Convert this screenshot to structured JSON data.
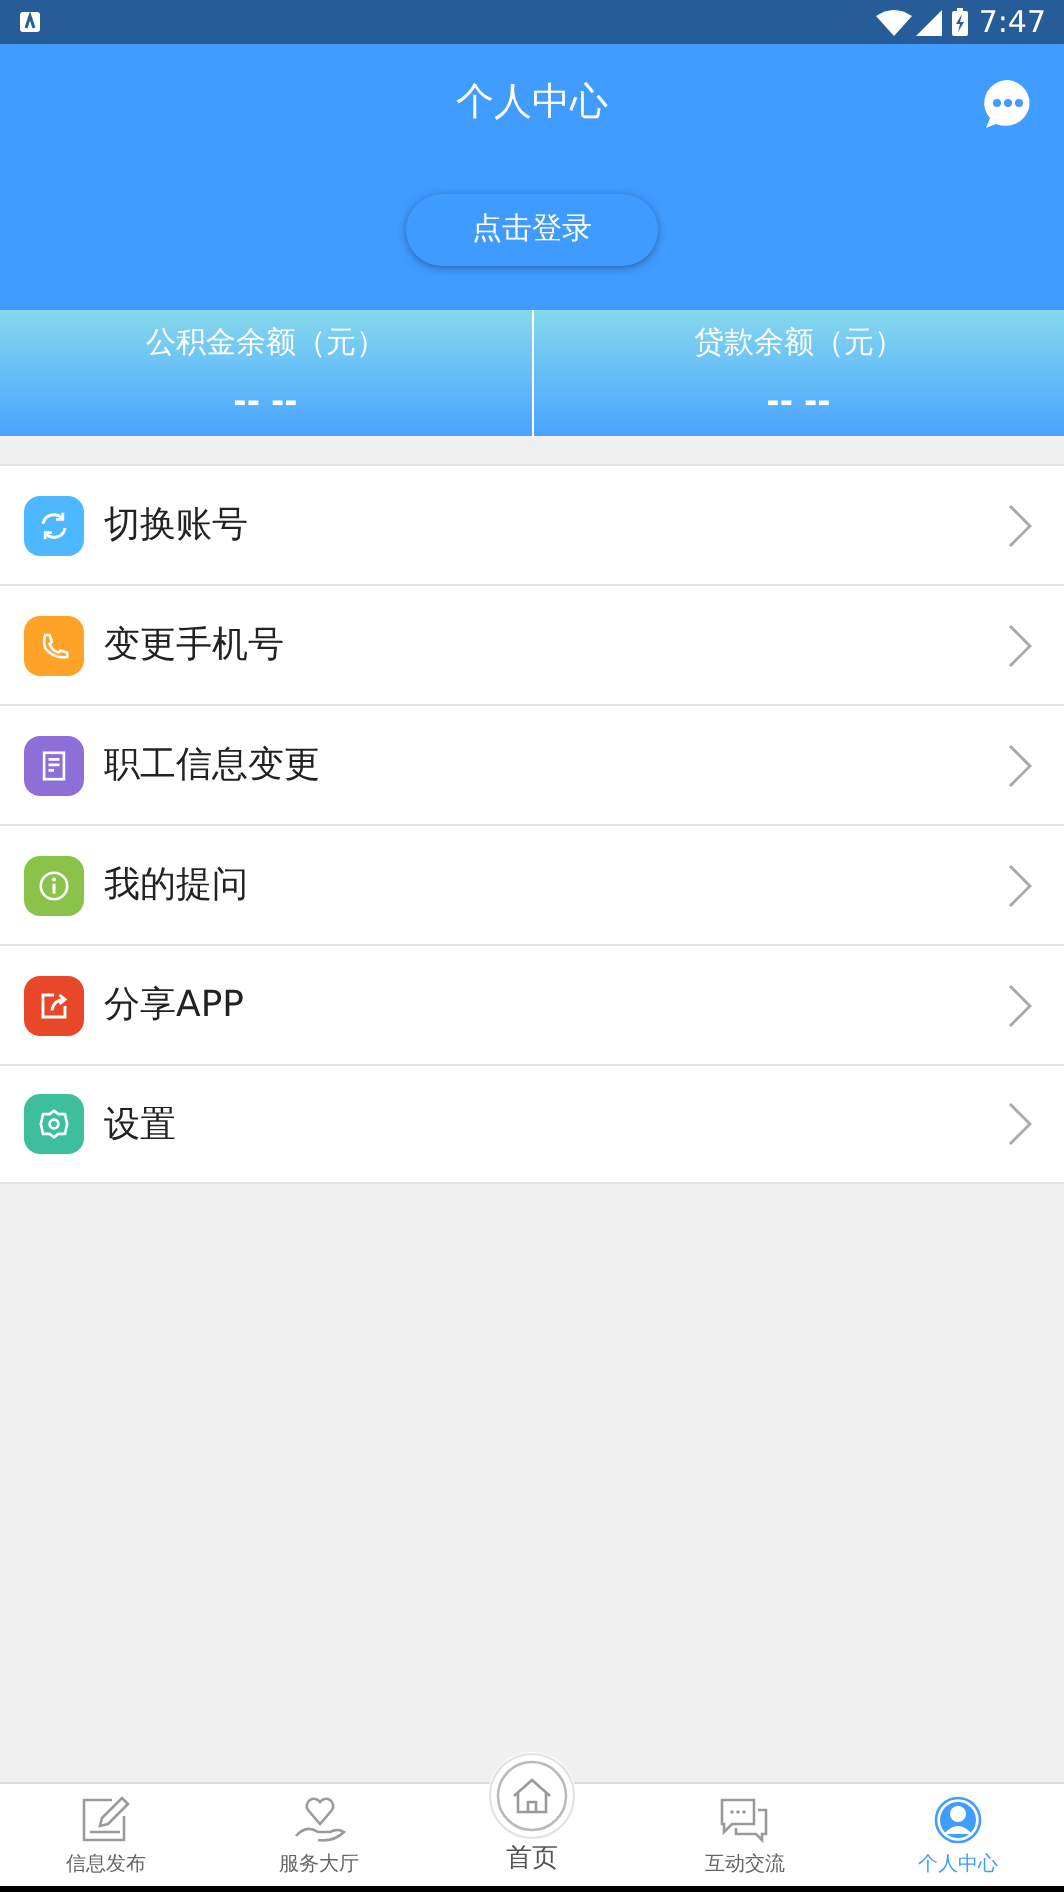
{
  "status_bar": {
    "time": "7:47"
  },
  "header": {
    "title": "个人中心",
    "login_button": "点击登录"
  },
  "balances": [
    {
      "label": "公积金余额（元）",
      "value": "-- --"
    },
    {
      "label": "贷款余额（元）",
      "value": "-- --"
    }
  ],
  "menu": [
    {
      "kind": "refresh",
      "color": "#4db8ff",
      "label": "切换账号"
    },
    {
      "kind": "phone",
      "color": "#ffa228",
      "label": "变更手机号"
    },
    {
      "kind": "document",
      "color": "#8e6fd8",
      "label": "职工信息变更"
    },
    {
      "kind": "info",
      "color": "#8bc34a",
      "label": "我的提问"
    },
    {
      "kind": "share",
      "color": "#e8472a",
      "label": "分享APP"
    },
    {
      "kind": "gear",
      "color": "#3dbf9c",
      "label": "设置"
    }
  ],
  "tab_bar": [
    {
      "kind": "edit",
      "label": "信息发布",
      "selected": false
    },
    {
      "kind": "hand",
      "label": "服务大厅",
      "selected": false
    },
    {
      "kind": "home",
      "label": "首页",
      "selected": false
    },
    {
      "kind": "chat",
      "label": "互动交流",
      "selected": false
    },
    {
      "kind": "person",
      "label": "个人中心",
      "selected": true
    }
  ]
}
